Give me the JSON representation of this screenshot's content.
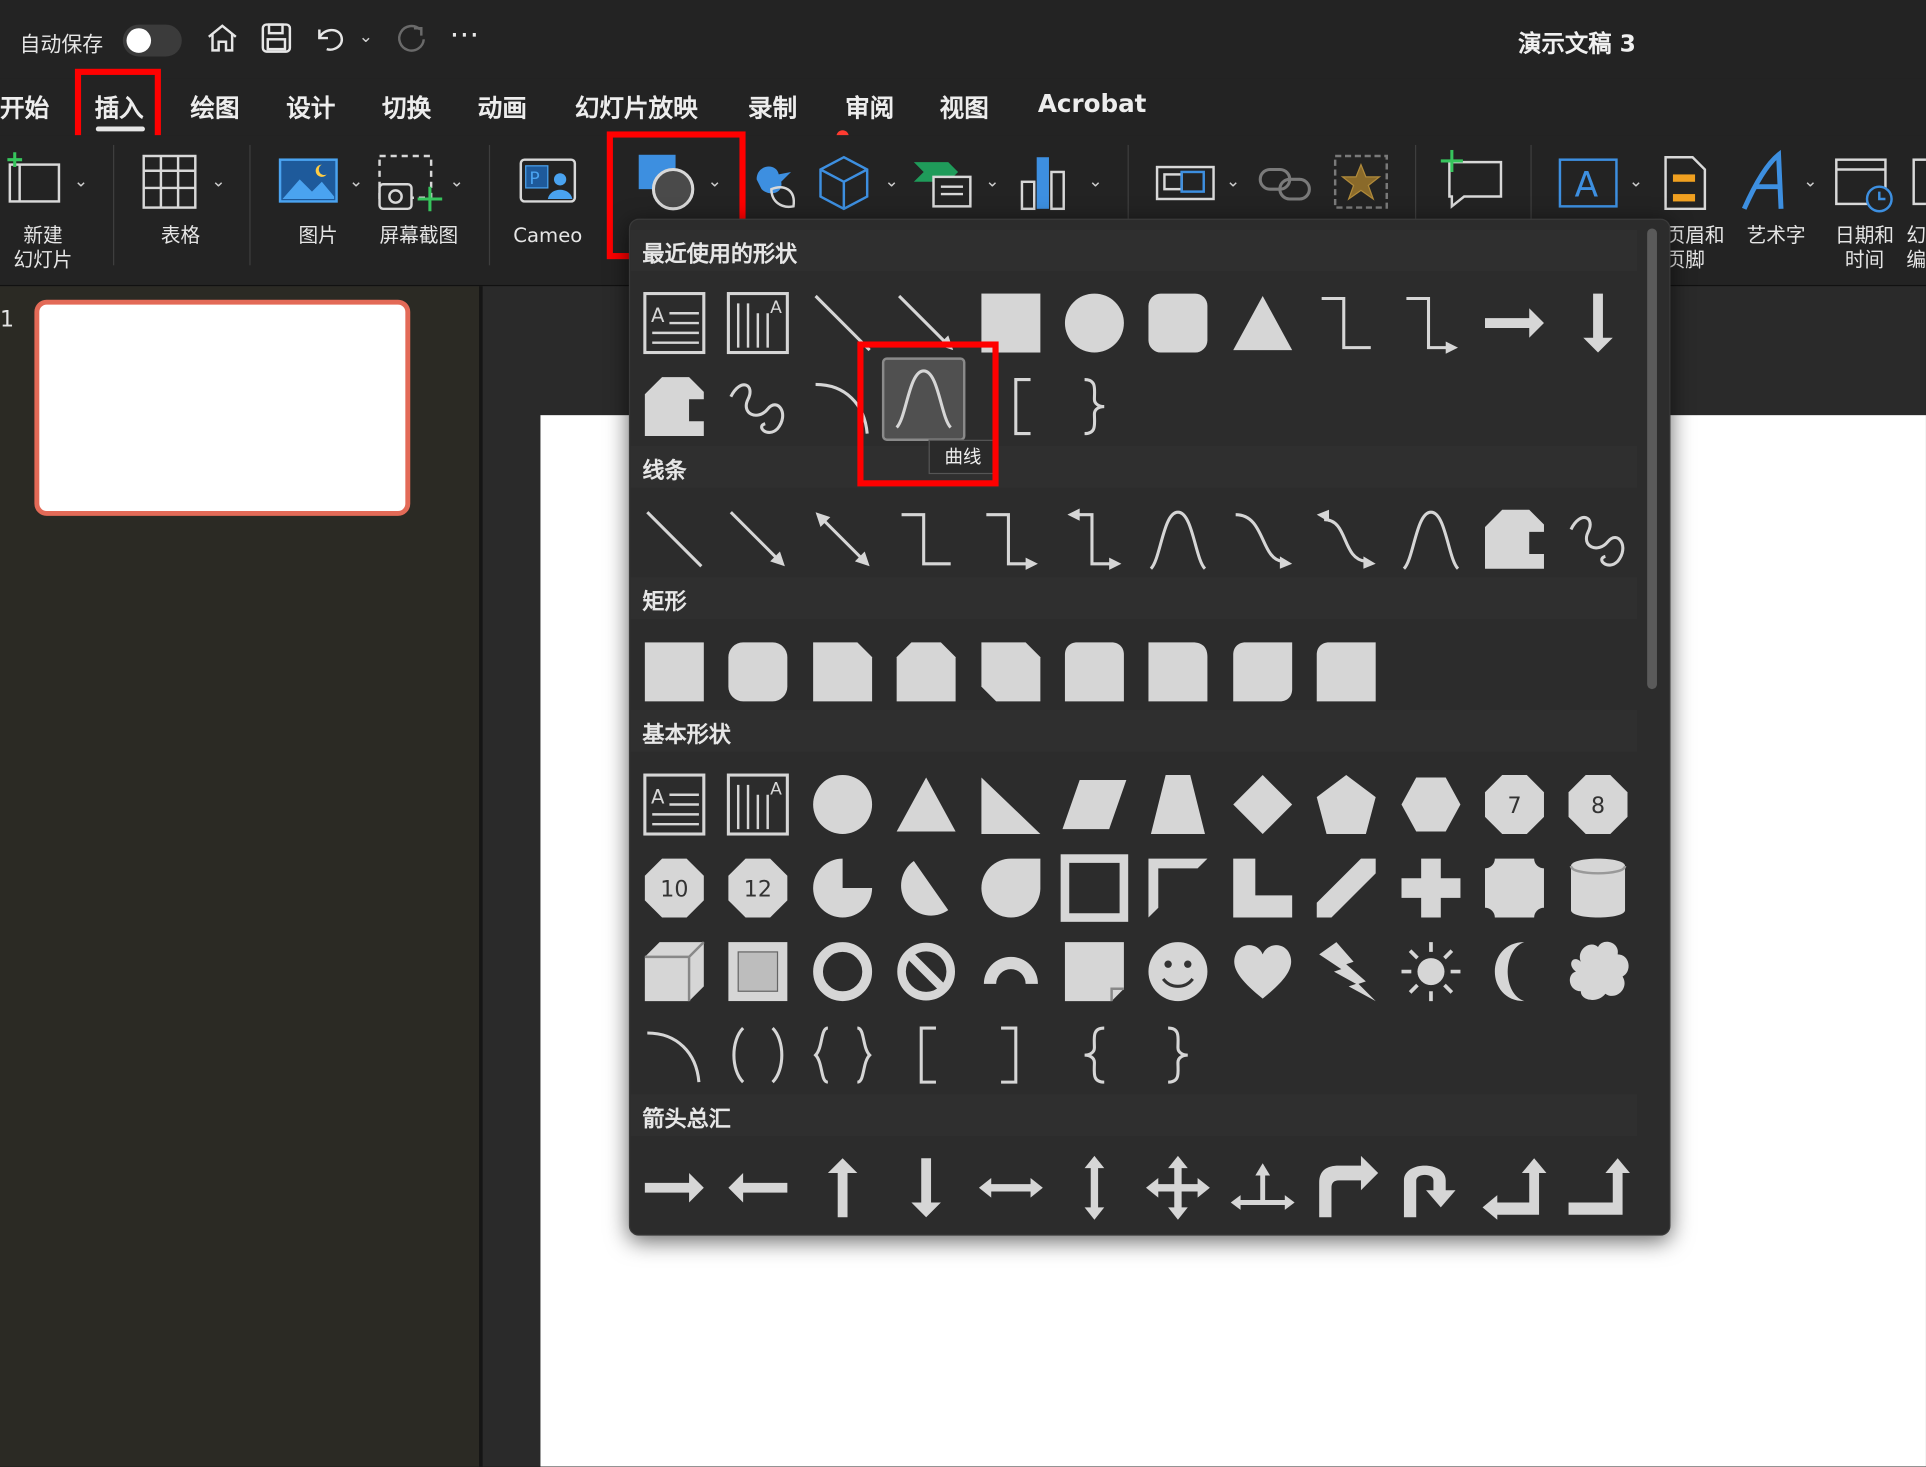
{
  "titlebar": {
    "autosave_label": "自动保存",
    "autosave_state": "off",
    "icons": [
      "home-icon",
      "save-icon",
      "undo-icon",
      "chevron-down-icon",
      "redo-icon",
      "more-icon"
    ],
    "document_title": "演示文稿 3"
  },
  "tabs": [
    "开始",
    "插入",
    "绘图",
    "设计",
    "切换",
    "动画",
    "幻灯片放映",
    "录制",
    "审阅",
    "视图",
    "Acrobat"
  ],
  "active_tab": "插入",
  "ribbon": {
    "new_slide": "新建\n幻灯片",
    "table": "表格",
    "pictures": "图片",
    "screenshot": "屏幕截图",
    "cameo": "Cameo",
    "header_footer": "页眉和\n页脚",
    "wordart": "艺术字",
    "datetime": "日期和\n时间",
    "truncated": "幻\n编"
  },
  "slide_pane": {
    "slide_number": "1"
  },
  "shapes_gallery": {
    "sections": [
      {
        "title": "最近使用的形状"
      },
      {
        "title": "线条"
      },
      {
        "title": "矩形"
      },
      {
        "title": "基本形状"
      },
      {
        "title": "箭头总汇"
      }
    ],
    "tooltip": "曲线",
    "octagon_labels": [
      "7",
      "8",
      "10",
      "12"
    ]
  },
  "colors": {
    "highlight": "#ff0000",
    "accent_thumb": "#e36a57",
    "shape_fill": "#d6d6d6"
  }
}
